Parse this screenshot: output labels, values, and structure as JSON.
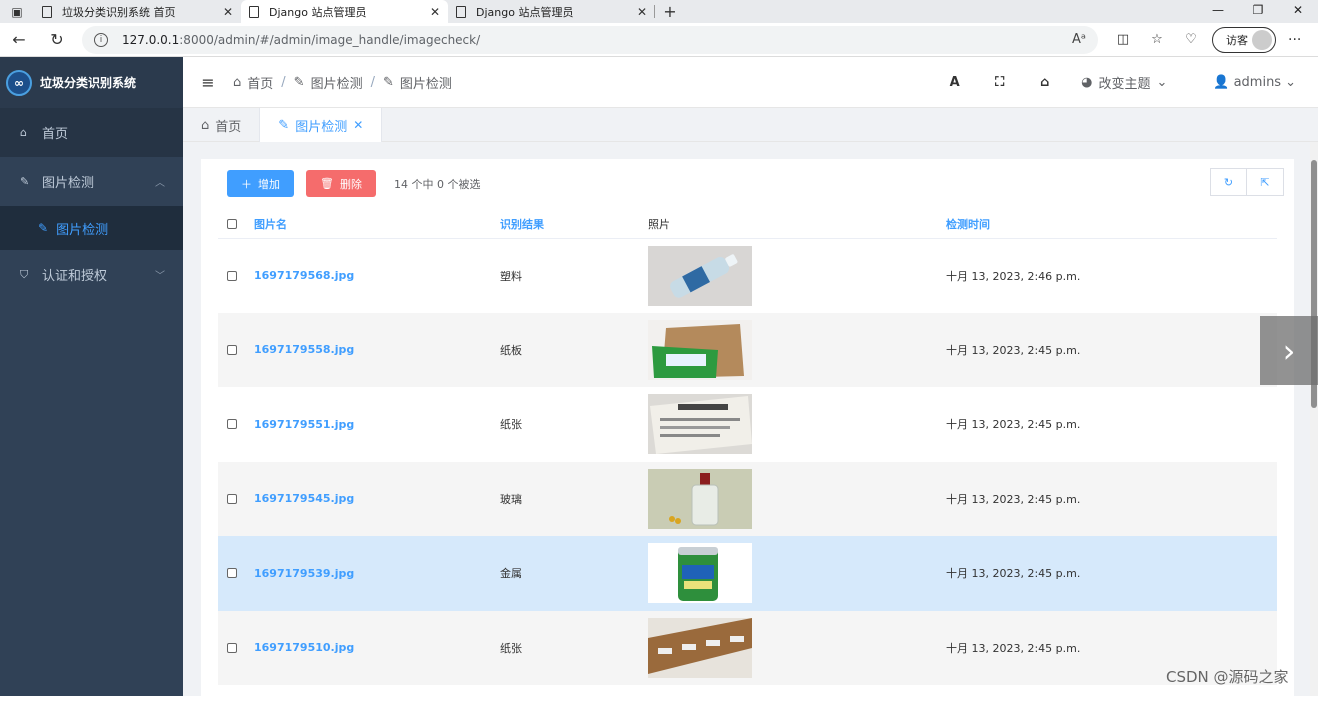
{
  "browser": {
    "tabs": [
      {
        "title": "垃圾分类识别系统 首页",
        "active": false
      },
      {
        "title": "Django 站点管理员",
        "active": true
      },
      {
        "title": "Django 站点管理员",
        "active": false
      }
    ],
    "url_host": "127.0.0.1",
    "url_path": ":8000/admin/#/admin/image_handle/imagecheck/",
    "guest_label": "访客"
  },
  "sidebar": {
    "app_name": "垃圾分类识别系统",
    "items": [
      {
        "label": "首页",
        "icon": "home-icon"
      },
      {
        "label": "图片检测",
        "icon": "brush-icon"
      },
      {
        "label": "认证和授权",
        "icon": "shield-icon"
      }
    ],
    "subitem": {
      "label": "图片检测",
      "icon": "brush-icon"
    }
  },
  "topbar": {
    "breadcrumb": [
      "首页",
      "图片检测",
      "图片检测"
    ],
    "theme_label": "改变主题",
    "user": "admins"
  },
  "tags": [
    {
      "label": "首页"
    },
    {
      "label": "图片检测"
    }
  ],
  "toolbar": {
    "add_label": "增加",
    "delete_label": "删除",
    "selection_info": "14 个中 0 个被选"
  },
  "table": {
    "headers": [
      "图片名",
      "识别结果",
      "照片",
      "检测时间"
    ],
    "rows": [
      {
        "name": "1697179568.jpg",
        "result": "塑料",
        "time": "十月 13, 2023, 2:46 p.m."
      },
      {
        "name": "1697179558.jpg",
        "result": "纸板",
        "time": "十月 13, 2023, 2:45 p.m."
      },
      {
        "name": "1697179551.jpg",
        "result": "纸张",
        "time": "十月 13, 2023, 2:45 p.m."
      },
      {
        "name": "1697179545.jpg",
        "result": "玻璃",
        "time": "十月 13, 2023, 2:45 p.m."
      },
      {
        "name": "1697179539.jpg",
        "result": "金属",
        "time": "十月 13, 2023, 2:45 p.m."
      },
      {
        "name": "1697179510.jpg",
        "result": "纸张",
        "time": "十月 13, 2023, 2:45 p.m."
      }
    ]
  },
  "watermark": "CSDN @源码之家",
  "colors": {
    "accent": "#409eff",
    "danger": "#f56c6c",
    "sidebar": "#304156"
  }
}
